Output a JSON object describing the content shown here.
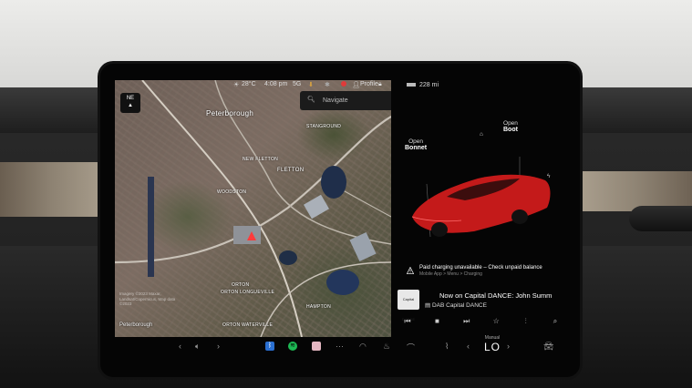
{
  "status_bar": {
    "temperature": "28°C",
    "time": "4:08 pm",
    "network": "5G",
    "profile_label": "Profile"
  },
  "map": {
    "compass": "NE",
    "city_label": "Peterborough",
    "search_placeholder": "Navigate",
    "places": [
      "STANGROUND",
      "NEW FLETTON",
      "FLETTON",
      "WOODSTON",
      "ORTON",
      "ORTON LONGUEVILLE",
      "HAMPTON",
      "ORTON WATERVILLE"
    ],
    "credits": "Imagery ©2023 Maxar, Landsat/Copernicus, Map data ©2023",
    "footer_city": "Peterborough"
  },
  "vehicle": {
    "range": "228 mi",
    "bonnet_action": "Open",
    "bonnet_label": "Bonnet",
    "boot_action": "Open",
    "boot_label": "Boot",
    "body_color": "#c41a1a"
  },
  "alert": {
    "title": "Paid charging unavailable – Check unpaid balance",
    "path": "Mobile App > Menu > Charging"
  },
  "media": {
    "album_text": "Capital DANCE",
    "now_playing": "Now on Capital DANCE: John Summ",
    "station": "DAB Capital DANCE",
    "controls": [
      "prev-icon",
      "stop-icon",
      "next-icon",
      "favorite-icon",
      "equalizer-icon",
      "search-icon"
    ]
  },
  "climate": {
    "mode": "Manual",
    "setting": "LO"
  }
}
